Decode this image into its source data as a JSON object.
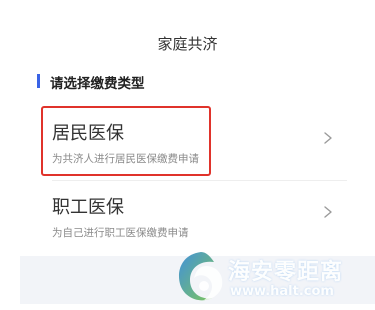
{
  "header": {
    "title": "家庭共济"
  },
  "section": {
    "label": "请选择缴费类型"
  },
  "options": [
    {
      "title": "居民医保",
      "description": "为共济人进行居民医保缴费申请"
    },
    {
      "title": "职工医保",
      "description": "为自己进行职工医保缴费申请"
    }
  ],
  "watermark": {
    "text": "海安零距离",
    "url": "www.halt.com"
  },
  "colors": {
    "accent": "#3a63e6",
    "highlight": "#e0332b"
  },
  "icons": {
    "chevron": "chevron-right-icon",
    "watermark_logo": "watermark-logo-icon"
  }
}
